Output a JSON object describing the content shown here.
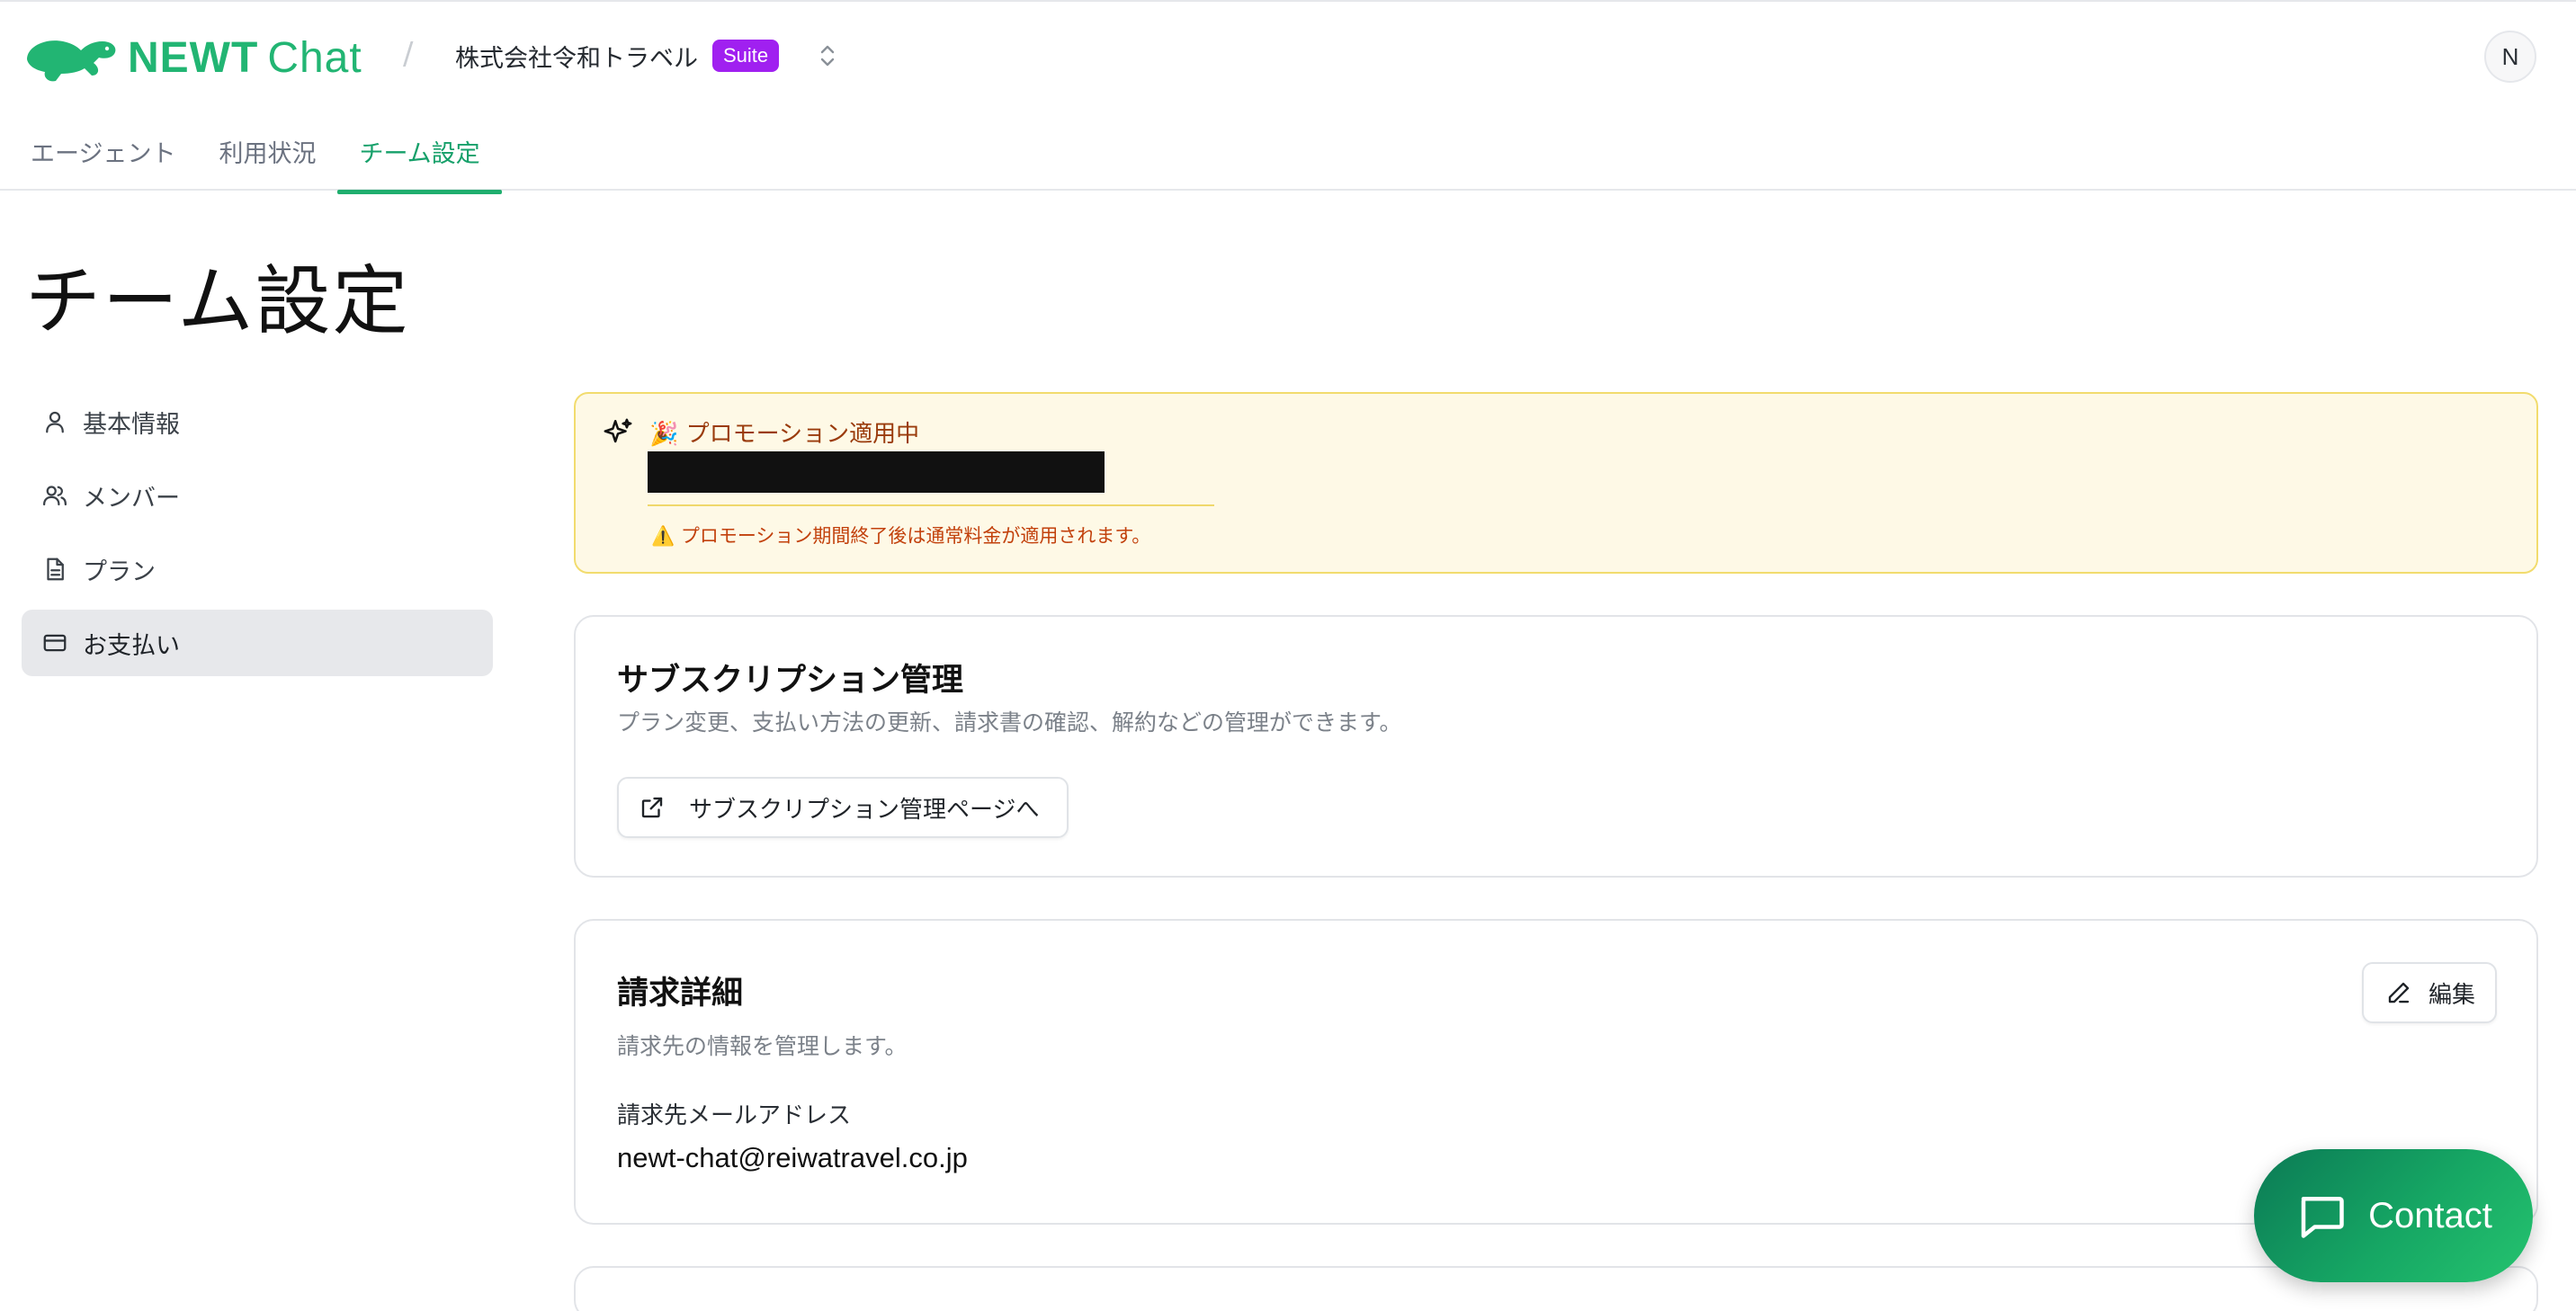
{
  "brand": {
    "name_bold": "NEWT",
    "name_light": "Chat"
  },
  "header": {
    "separator": "/",
    "org_name": "株式会社令和トラベル",
    "plan_badge": "Suite",
    "avatar_initial": "N"
  },
  "tabs": [
    {
      "label": "エージェント"
    },
    {
      "label": "利用状況"
    },
    {
      "label": "チーム設定",
      "active": true
    }
  ],
  "page": {
    "title": "チーム設定"
  },
  "sidebar": {
    "items": [
      {
        "label": "基本情報",
        "icon": "user-icon"
      },
      {
        "label": "メンバー",
        "icon": "users-icon"
      },
      {
        "label": "プラン",
        "icon": "document-icon"
      },
      {
        "label": "お支払い",
        "icon": "credit-card-icon",
        "active": true
      }
    ]
  },
  "promotion": {
    "title": "🎉 プロモーション適用中",
    "warning": "⚠️ プロモーション期間終了後は通常料金が適用されます。"
  },
  "subscription": {
    "title": "サブスクリプション管理",
    "description": "プラン変更、支払い方法の更新、請求書の確認、解約などの管理ができます。",
    "button_label": "サブスクリプション管理ページへ"
  },
  "billing": {
    "title": "請求詳細",
    "description": "請求先の情報を管理します。",
    "edit_label": "編集",
    "email_label": "請求先メールアドレス",
    "email_value": "newt-chat@reiwatravel.co.jp"
  },
  "contact": {
    "label": "Contact"
  },
  "colors": {
    "brand_green": "#22b573",
    "suite_purple": "#a020f0",
    "promo_bg": "#fef9e6",
    "promo_border": "#f2dc6e"
  }
}
